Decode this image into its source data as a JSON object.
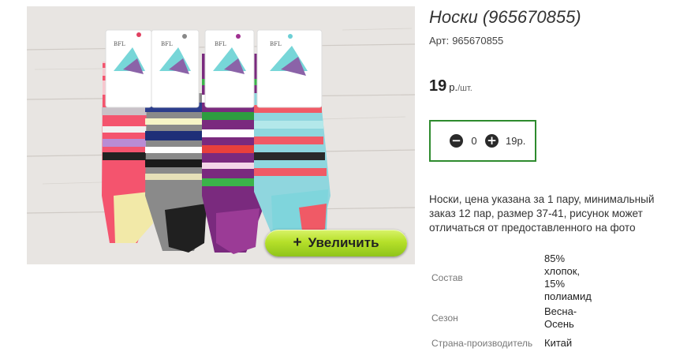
{
  "product": {
    "title": "Носки (965670855)",
    "sku_label": "Арт:",
    "sku_value": "965670855",
    "image_alt": "Носки",
    "zoom_label": "Увеличить",
    "zoom_icon": "plus-icon",
    "tag_brand": "BFL"
  },
  "price": {
    "amount": "19",
    "currency": "р.",
    "unit": "/шт."
  },
  "quantity": {
    "value": "0",
    "sum": "19р.",
    "minus_icon": "minus-circle-icon",
    "plus_icon": "plus-circle-icon",
    "border_color": "#2e8b2e"
  },
  "description": "Носки, цена указана за 1 пару, минимальный заказ 12 пар, размер 37-41, рисунок может отличаться от предоставленного на фото",
  "specs": [
    {
      "label": "Состав",
      "value": "85% хлопок, 15% полиамид"
    },
    {
      "label": "Сезон",
      "value": "Весна-Осень"
    },
    {
      "label": "Страна-производитель",
      "value": "Китай"
    }
  ],
  "colors": {
    "zoom_button": "#b6e02a",
    "text": "#333333"
  }
}
